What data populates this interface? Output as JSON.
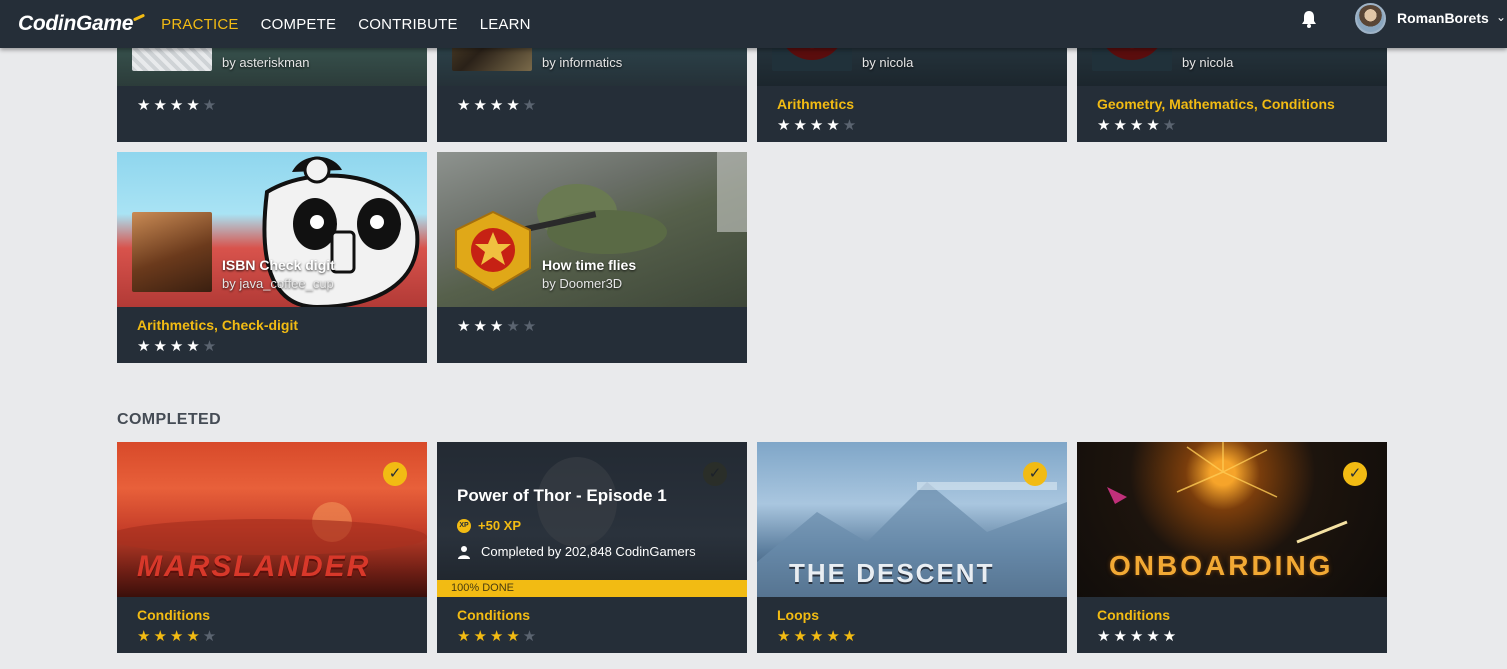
{
  "nav": {
    "logo": "CodinGame",
    "items": [
      {
        "label": "PRACTICE",
        "active": true
      },
      {
        "label": "COMPETE",
        "active": false
      },
      {
        "label": "CONTRIBUTE",
        "active": false
      },
      {
        "label": "LEARN",
        "active": false
      }
    ],
    "bell_icon": "bell-icon",
    "username": "RomanBorets",
    "chevron": "⌄"
  },
  "puzzles_row1": [
    {
      "author": "by asteriskman",
      "tags": [],
      "rating": 4
    },
    {
      "author": "by informatics",
      "tags": [],
      "rating": 4
    },
    {
      "author": "by nicola",
      "tags": [
        "Arithmetics"
      ],
      "rating": 4
    },
    {
      "author": "by nicola",
      "tags": [
        "Geometry",
        "Mathematics",
        "Conditions"
      ],
      "rating": 4
    }
  ],
  "puzzles_row2": [
    {
      "title": "ISBN Check digit",
      "author": "by java_coffee_cup",
      "tags": [
        "Arithmetics",
        "Check-digit"
      ],
      "rating": 4
    },
    {
      "title": "How time flies",
      "author": "by Doomer3D",
      "tags": [],
      "rating": 3
    }
  ],
  "completed": {
    "section_title": "COMPLETED",
    "cards": [
      {
        "art_title": "MARSLANDER",
        "tags": [
          "Conditions"
        ],
        "rating": 4,
        "stars_gold": true
      },
      {
        "title": "Power of Thor - Episode 1",
        "xp_badge": "XP",
        "xp": "+50 XP",
        "completed_by": "Completed by 202,848 CodinGamers",
        "progress_label": "100% DONE",
        "progress": 1.0,
        "tags": [
          "Conditions"
        ],
        "rating": 4,
        "stars_gold": true
      },
      {
        "art_title": "THE DESCENT",
        "tags": [
          "Loops"
        ],
        "rating": 5,
        "stars_gold": true
      },
      {
        "art_title": "ONBOARDING",
        "tags": [
          "Conditions"
        ],
        "rating": 5,
        "stars_gold": false
      }
    ]
  },
  "colors": {
    "accent": "#f2bb13",
    "panel": "#252e38",
    "background": "#e9eaec"
  }
}
